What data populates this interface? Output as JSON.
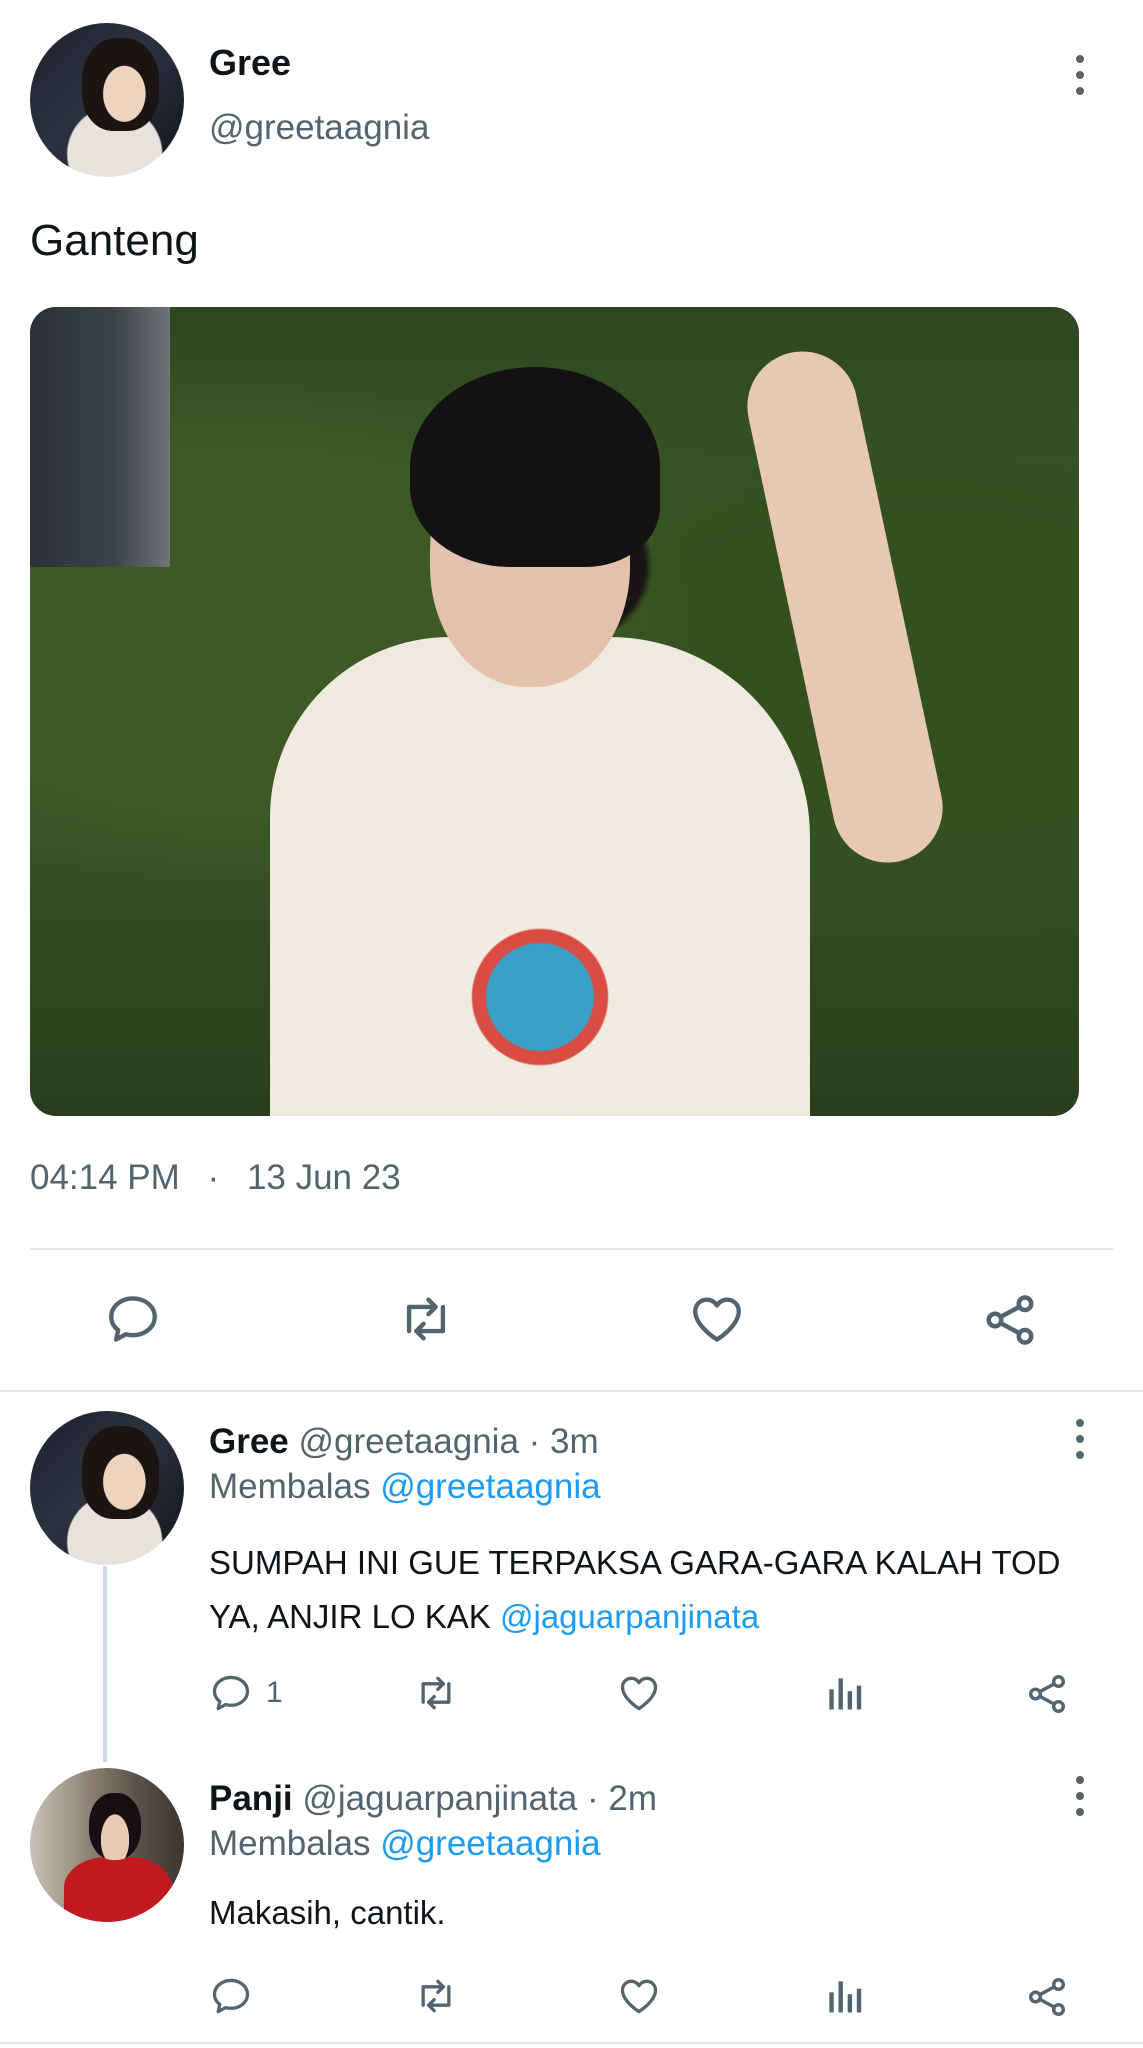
{
  "tweet": {
    "author_name": "Gree",
    "author_handle": "@greetaagnia",
    "text": "Ganteng",
    "time": "04:14 PM",
    "separator": "·",
    "date": "13 Jun 23"
  },
  "action_bar": {
    "icons": [
      "reply-icon",
      "retweet-icon",
      "like-icon",
      "share-icon"
    ]
  },
  "replies": [
    {
      "author_name": "Gree",
      "author_handle": "@greetaagnia",
      "age": "· 3m",
      "replying_prefix": "Membalas",
      "replying_to": "@greetaagnia",
      "text": "SUMPAH INI GUE TERPAKSA GARA-GARA KALAH TOD YA, ANJIR LO KAK",
      "mention": "@jaguarpanjinata",
      "reply_count": "1"
    },
    {
      "author_name": "Panji",
      "author_handle": "@jaguarpanjinata",
      "age": "· 2m",
      "replying_prefix": "Membalas",
      "replying_to": "@greetaagnia",
      "text": "Makasih, cantik.",
      "reply_count": ""
    }
  ],
  "colors": {
    "text_primary": "#0f1419",
    "text_secondary": "#536471",
    "link": "#1d9bf0",
    "divider": "#e1e6ea"
  }
}
